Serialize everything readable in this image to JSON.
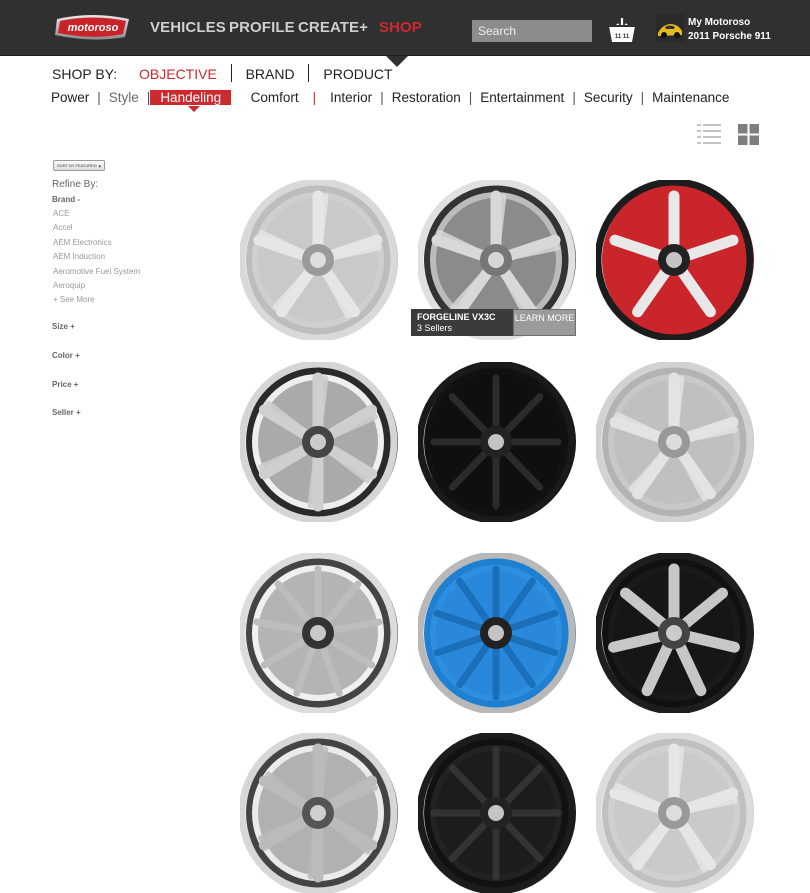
{
  "header": {
    "logo_text": "motoroso",
    "nav": [
      {
        "label": "VEHICLES",
        "active": false
      },
      {
        "label": "PROFILE",
        "active": false
      },
      {
        "label": "CREATE+",
        "active": false
      },
      {
        "label": "SHOP",
        "active": true
      }
    ],
    "search_placeholder": "Search",
    "basket_count": "11 11",
    "my_title": "My Motoroso",
    "my_car": "2011 Porsche 911"
  },
  "shop_by": {
    "label": "SHOP BY:",
    "options": [
      {
        "label": "OBJECTIVE",
        "active": true
      },
      {
        "label": "BRAND",
        "active": false
      },
      {
        "label": "PRODUCT",
        "active": false
      }
    ]
  },
  "categories": [
    {
      "label": "Power",
      "active": false
    },
    {
      "label": "Style",
      "active": false
    },
    {
      "label": "Handeling",
      "active": true
    },
    {
      "label": "Comfort",
      "active": false
    },
    {
      "label": "Interior",
      "active": false
    },
    {
      "label": "Restoration",
      "active": false
    },
    {
      "label": "Entertainment",
      "active": false
    },
    {
      "label": "Security",
      "active": false
    },
    {
      "label": "Maintenance",
      "active": false
    }
  ],
  "view_toggle": {
    "list_icon": "list-view-icon",
    "grid_icon": "grid-view-icon",
    "selected": "grid"
  },
  "sidebar": {
    "sort_label": "SORT BY FEATURED",
    "refine_label": "Refine By:",
    "brand_heading": "Brand -",
    "brands": [
      "ACE",
      "Accel",
      "AEM Electronics",
      "AEM Induction",
      "Aeromotive Fuel System",
      "Aeroquip",
      "+ See More"
    ],
    "facets": [
      "Size +",
      "Color +",
      "Price +",
      "Seller +"
    ]
  },
  "products": [
    {
      "style": "silver-5-spoke"
    },
    {
      "style": "chrome-lip-5-spoke"
    },
    {
      "style": "red-barrel-black-face"
    },
    {
      "style": "chrome-split-spoke"
    },
    {
      "style": "black-8-spoke-offroad"
    },
    {
      "style": "brushed-10-spoke"
    },
    {
      "style": "chrome-blade"
    },
    {
      "style": "blue-10-spoke"
    },
    {
      "style": "black-machined-offroad"
    },
    {
      "style": "chrome-partial"
    },
    {
      "style": "black-partial"
    },
    {
      "style": "silver-partial"
    }
  ],
  "tooltip": {
    "name": "FORGELINE VX3C",
    "sellers": "3 Sellers",
    "learn_more": "LEARN MORE"
  },
  "colors": {
    "topbar": "#303030",
    "accent_red": "#cc2a2f",
    "nav_text": "#cfcfcf"
  }
}
